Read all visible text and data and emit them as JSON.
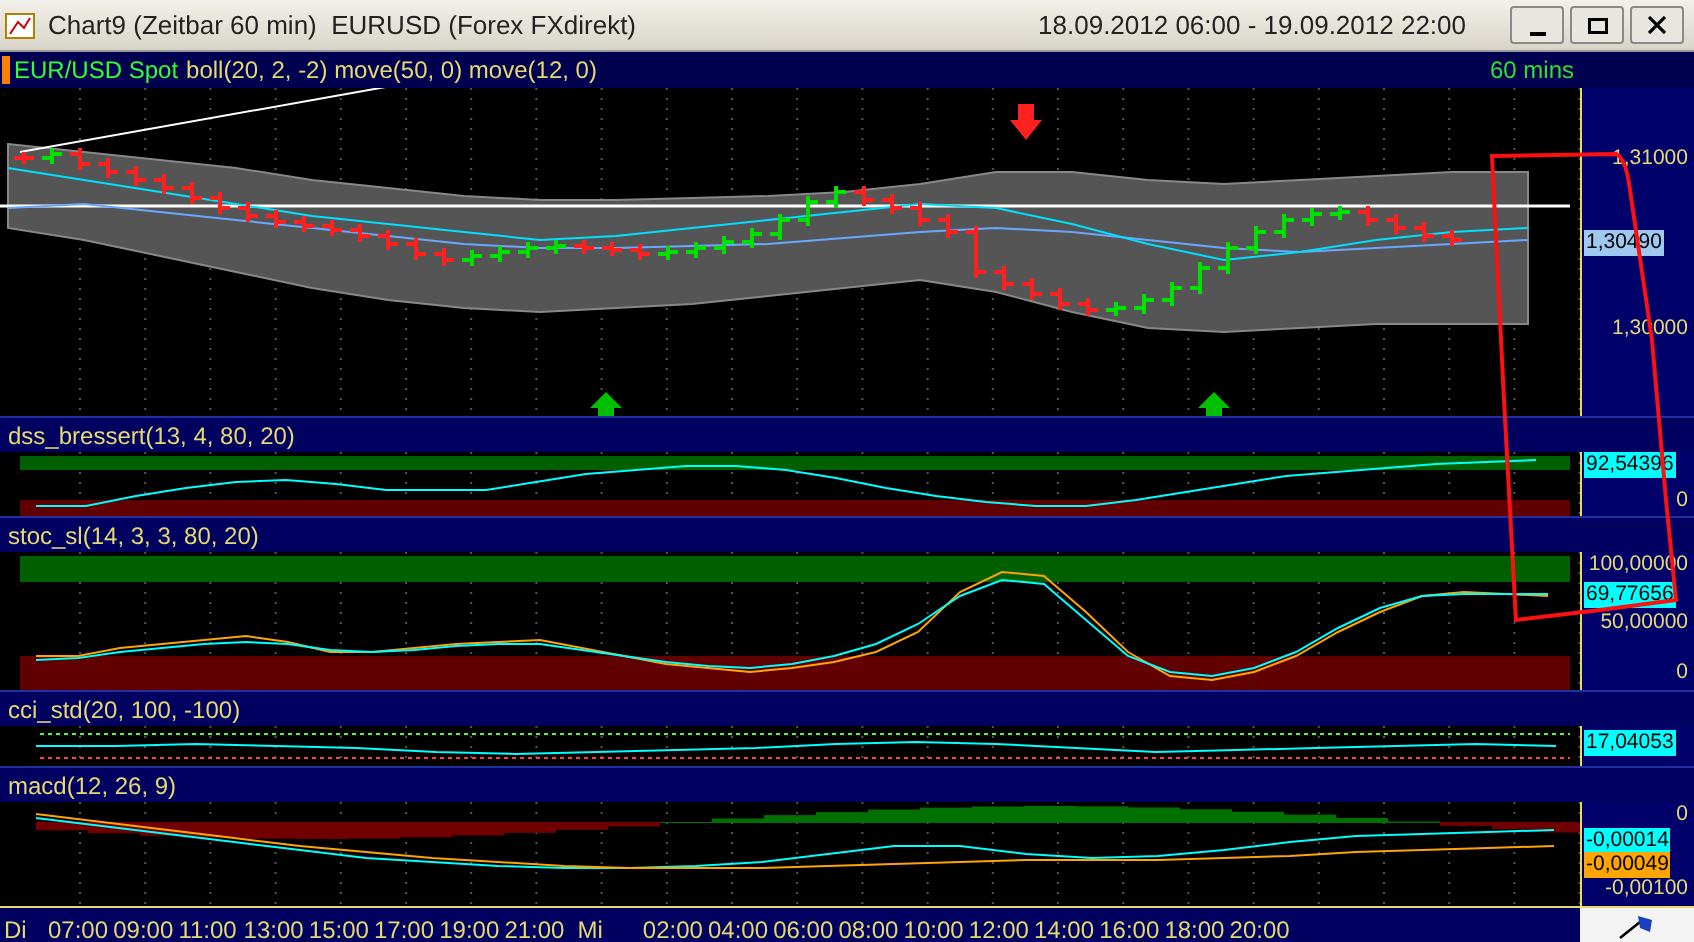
{
  "window": {
    "title": "Chart9 (Zeitbar 60 min)  EURUSD (Forex FXdirekt)",
    "date_range": "18.09.2012 06:00 - 19.09.2012 22:00"
  },
  "main_panel": {
    "symbol": "EUR/USD Spot",
    "indicators": "boll(20, 2, -2) move(50, 0) move(12, 0)",
    "interval": "60 mins",
    "axis_labels": [
      {
        "text": "1,31000",
        "kind": "tick"
      },
      {
        "text": "1,30490",
        "kind": "value",
        "color": "#9ec8f0"
      },
      {
        "text": "1,30000",
        "kind": "tick"
      }
    ]
  },
  "indicator_panels": [
    {
      "kind": "dss",
      "title": "dss_bressert(13, 4, 80, 20)",
      "axis_labels": [
        {
          "text": "92,54396",
          "kind": "value",
          "color": "#00ffff"
        },
        {
          "text": "0",
          "kind": "tick"
        }
      ]
    },
    {
      "kind": "stoc",
      "title": "stoc_sl(14, 3, 3, 80, 20)",
      "axis_labels": [
        {
          "text": "100,00000",
          "kind": "tick"
        },
        {
          "text": "69,77656",
          "kind": "value",
          "color": "#00ffff"
        },
        {
          "text": "50,00000",
          "kind": "tick"
        },
        {
          "text": "0",
          "kind": "tick"
        }
      ]
    },
    {
      "kind": "cci",
      "title": "cci_std(20, 100, -100)",
      "axis_labels": [
        {
          "text": "17,04053",
          "kind": "value",
          "color": "#00ffff"
        }
      ]
    },
    {
      "kind": "macd",
      "title": "macd(12, 26, 9)",
      "axis_labels": [
        {
          "text": "0",
          "kind": "tick"
        },
        {
          "text": "-0,00014",
          "kind": "value",
          "color": "#00ffff"
        },
        {
          "text": "-0,00049",
          "kind": "value",
          "color": "#ffa500"
        },
        {
          "text": "-0,00100",
          "kind": "tick"
        }
      ]
    }
  ],
  "time_axis": [
    "Di",
    "07:00",
    "09:00",
    "11:00",
    "13:00",
    "15:00",
    "17:00",
    "19:00",
    "21:00",
    "Mi",
    "02:00",
    "04:00",
    "06:00",
    "08:00",
    "10:00",
    "12:00",
    "14:00",
    "16:00",
    "18:00",
    "20:00"
  ]
}
